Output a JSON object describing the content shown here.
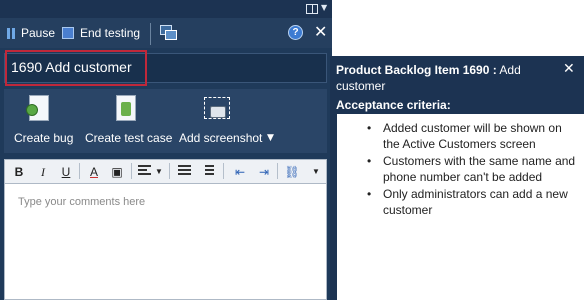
{
  "runner": {
    "pause_label": "Pause",
    "end_testing_label": "End testing",
    "title": "1690 Add customer",
    "actions": {
      "create_bug": "Create bug",
      "create_test_case": "Create test case",
      "add_screenshot": "Add screenshot"
    },
    "format": {
      "bold": "B",
      "italic": "I",
      "underline": "U",
      "font_color": "A"
    },
    "comments_placeholder": "Type your comments here"
  },
  "work_item": {
    "heading_bold": "Product Backlog Item 1690 :",
    "heading_title": "Add customer",
    "acceptance_label": "Acceptance criteria:",
    "criteria": [
      "Added customer will be shown on the Active Customers screen",
      "Customers with the same name and phone number can't be added",
      "Only administrators can add a new customer"
    ]
  },
  "colors": {
    "panel_bg": "#1f3a5a",
    "highlight": "#c0283a"
  }
}
